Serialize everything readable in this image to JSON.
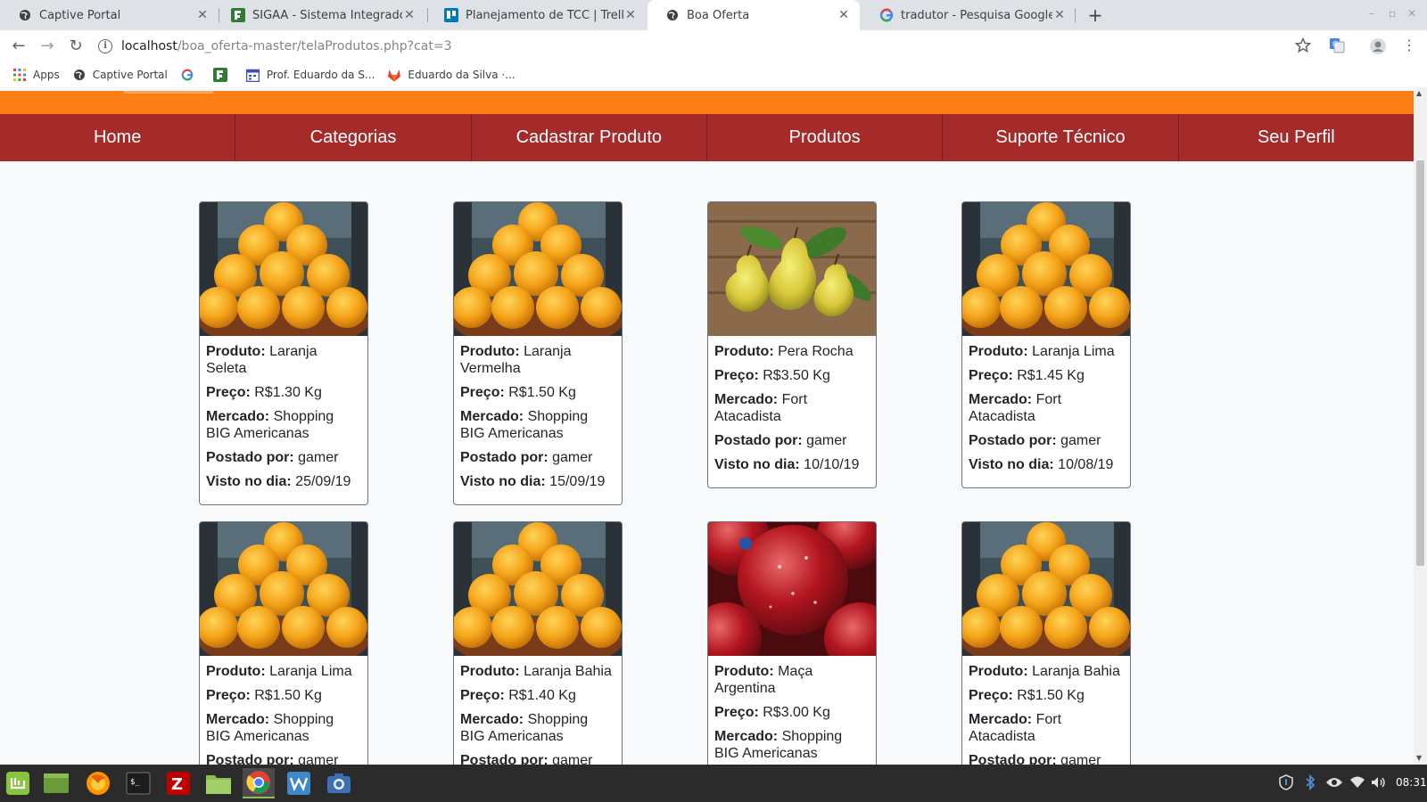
{
  "browser": {
    "tabs": [
      {
        "title": "Captive Portal",
        "icon": "globe-icon"
      },
      {
        "title": "SIGAA - Sistema Integrado de G",
        "icon": "sigaa-icon"
      },
      {
        "title": "Planejamento de TCC | Trello",
        "icon": "trello-icon"
      },
      {
        "title": "Boa Oferta",
        "icon": "globe-icon"
      },
      {
        "title": "tradutor - Pesquisa Google",
        "icon": "google-icon"
      }
    ],
    "active_tab": 3,
    "url_host": "localhost",
    "url_path": "/boa_oferta-master/telaProdutos.php?cat=3",
    "bookmarks": [
      {
        "label": "Apps",
        "icon": "apps-grid-icon"
      },
      {
        "label": "Captive Portal",
        "icon": "globe-icon"
      },
      {
        "label": "",
        "icon": "google-icon"
      },
      {
        "label": "",
        "icon": "sigaa-icon"
      },
      {
        "label": "Prof. Eduardo da S...",
        "icon": "calendar-icon"
      },
      {
        "label": "Eduardo da Silva ·...",
        "icon": "gitlab-icon"
      }
    ]
  },
  "nav": {
    "items": [
      "Home",
      "Categorias",
      "Cadastrar Produto",
      "Produtos",
      "Suporte Técnico",
      "Seu Perfil"
    ]
  },
  "labels": {
    "produto": "Produto:",
    "preco": "Preço:",
    "mercado": "Mercado:",
    "postado": "Postado por:",
    "visto": "Visto no dia:"
  },
  "products": [
    {
      "name": "Laranja Seleta",
      "price": "R$1.30 Kg",
      "market": "Shopping BIG Americanas",
      "user": "gamer",
      "date": "25/09/19",
      "image": "oranges"
    },
    {
      "name": "Laranja Vermelha",
      "price": "R$1.50 Kg",
      "market": "Shopping BIG Americanas",
      "user": "gamer",
      "date": "15/09/19",
      "image": "oranges"
    },
    {
      "name": "Pera Rocha",
      "price": "R$3.50 Kg",
      "market": "Fort Atacadista",
      "user": "gamer",
      "date": "10/10/19",
      "image": "pears"
    },
    {
      "name": "Laranja Lima",
      "price": "R$1.45 Kg",
      "market": "Fort Atacadista",
      "user": "gamer",
      "date": "10/08/19",
      "image": "oranges"
    },
    {
      "name": "Laranja Lima",
      "price": "R$1.50 Kg",
      "market": "Shopping BIG Americanas",
      "user": "gamer",
      "date": "",
      "image": "oranges"
    },
    {
      "name": "Laranja Bahia",
      "price": "R$1.40 Kg",
      "market": "Shopping BIG Americanas",
      "user": "gamer",
      "date": "",
      "image": "oranges"
    },
    {
      "name": "Maça Argentina",
      "price": "R$3.00 Kg",
      "market": "Shopping BIG Americanas",
      "user": "",
      "date": "",
      "image": "apples"
    },
    {
      "name": "Laranja Bahia",
      "price": "R$1.50 Kg",
      "market": "Fort Atacadista",
      "user": "gamer",
      "date": "",
      "image": "oranges"
    }
  ],
  "taskbar": {
    "apps": [
      "mint-menu-icon",
      "show-desktop-icon",
      "firefox-icon",
      "terminal-icon",
      "filezilla-icon",
      "files-icon",
      "chrome-icon",
      "mysql-workbench-icon",
      "screenshot-icon"
    ],
    "tray": [
      "shield-icon",
      "bluetooth-icon",
      "eye-icon",
      "wifi-icon",
      "volume-icon"
    ],
    "clock": "08:31"
  }
}
